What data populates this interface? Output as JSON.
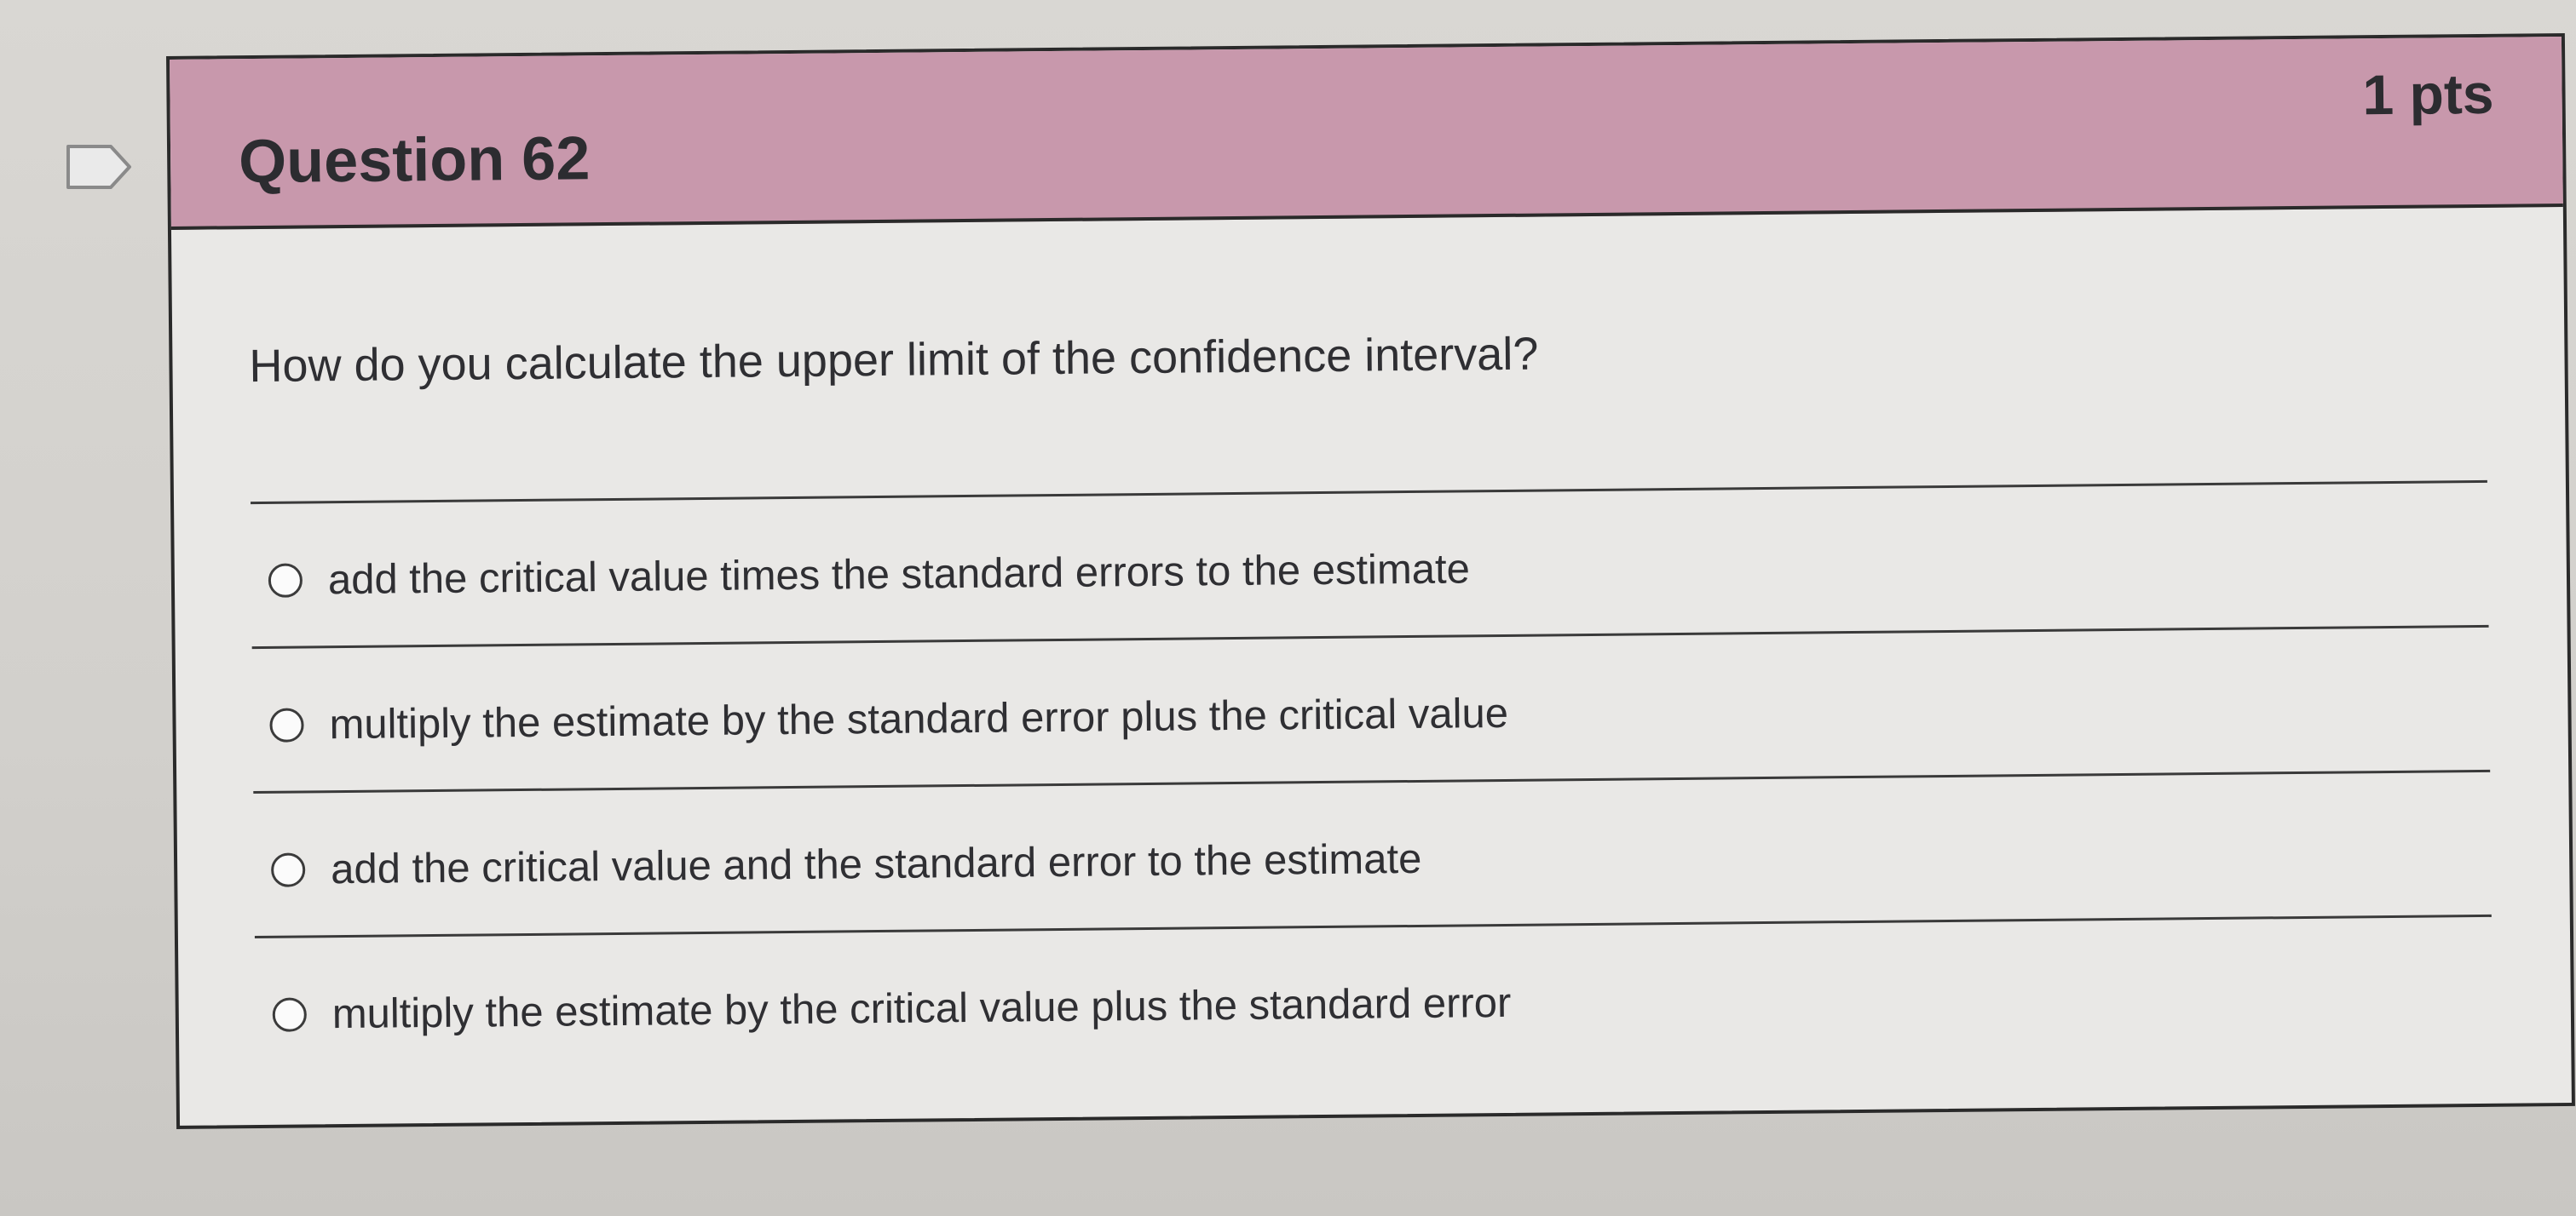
{
  "question": {
    "title": "Question 62",
    "points": "1 pts",
    "text": "How do you calculate the upper limit of the confidence interval?",
    "options": [
      "add the critical value times the standard errors to the estimate",
      "multiply the estimate by the standard error plus the critical value",
      "add the critical value and the standard error to the estimate",
      "multiply the estimate by the critical value plus the standard error"
    ]
  },
  "colors": {
    "header_bg": "#c898ac",
    "card_bg": "#e9e8e6",
    "border": "#2a2a2a"
  },
  "icons": {
    "flag": "flag-question-icon"
  }
}
